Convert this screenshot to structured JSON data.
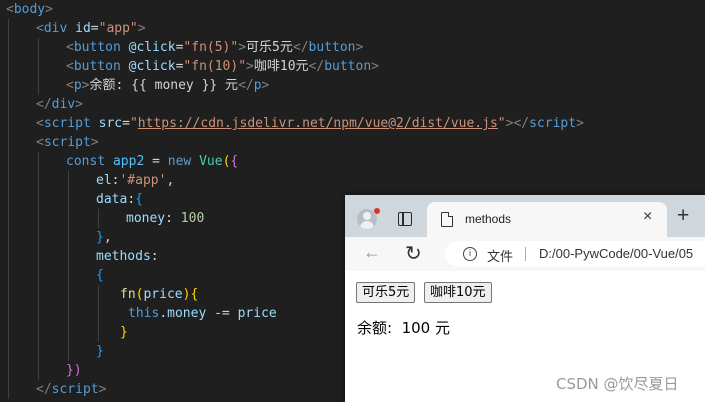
{
  "code": {
    "lines": [
      {
        "tokens": [
          [
            "<",
            "punc"
          ],
          [
            "body",
            "tag"
          ],
          [
            ">",
            "punc"
          ]
        ]
      },
      {
        "tokens": [
          [
            "<",
            "punc"
          ],
          [
            "div",
            "tag"
          ],
          [
            " ",
            ""
          ],
          [
            "id",
            "attr"
          ],
          [
            "=",
            "text"
          ],
          [
            "\"app\"",
            "str"
          ],
          [
            ">",
            "punc"
          ]
        ]
      },
      {
        "tokens": [
          [
            "<",
            "punc"
          ],
          [
            "button",
            "tag"
          ],
          [
            " ",
            ""
          ],
          [
            "@click",
            "attr"
          ],
          [
            "=",
            "text"
          ],
          [
            "\"fn(5)\"",
            "str"
          ],
          [
            ">",
            "punc"
          ],
          [
            "可乐5元",
            "text"
          ],
          [
            "</",
            "punc"
          ],
          [
            "button",
            "tag"
          ],
          [
            ">",
            "punc"
          ]
        ]
      },
      {
        "tokens": [
          [
            "<",
            "punc"
          ],
          [
            "button",
            "tag"
          ],
          [
            " ",
            ""
          ],
          [
            "@click",
            "attr"
          ],
          [
            "=",
            "text"
          ],
          [
            "\"fn(10)\"",
            "str"
          ],
          [
            ">",
            "punc"
          ],
          [
            "咖啡10元",
            "text"
          ],
          [
            "</",
            "punc"
          ],
          [
            "button",
            "tag"
          ],
          [
            ">",
            "punc"
          ]
        ]
      },
      {
        "tokens": [
          [
            "<",
            "punc"
          ],
          [
            "p",
            "tag"
          ],
          [
            ">",
            "punc"
          ],
          [
            "余额: {{ money }} 元",
            "text"
          ],
          [
            "</",
            "punc"
          ],
          [
            "p",
            "tag"
          ],
          [
            ">",
            "punc"
          ]
        ]
      },
      {
        "tokens": [
          [
            "</",
            "punc"
          ],
          [
            "div",
            "tag"
          ],
          [
            ">",
            "punc"
          ]
        ]
      },
      {
        "tokens": [
          [
            "<",
            "punc"
          ],
          [
            "script",
            "tag"
          ],
          [
            " ",
            ""
          ],
          [
            "src",
            "attr"
          ],
          [
            "=",
            "text"
          ],
          [
            "\"",
            "str"
          ],
          [
            "https://cdn.jsdelivr.net/npm/vue@2/dist/vue.js",
            "link"
          ],
          [
            "\"",
            "str"
          ],
          [
            "></",
            "punc"
          ],
          [
            "script",
            "tag"
          ],
          [
            ">",
            "punc"
          ]
        ]
      },
      {
        "tokens": [
          [
            "<",
            "punc"
          ],
          [
            "script",
            "tag"
          ],
          [
            ">",
            "punc"
          ]
        ]
      },
      {
        "tokens": [
          [
            "const",
            "kw"
          ],
          [
            " ",
            ""
          ],
          [
            "app2",
            "var"
          ],
          [
            " = ",
            "op"
          ],
          [
            "new",
            "kw"
          ],
          [
            " ",
            ""
          ],
          [
            "Vue",
            "cls"
          ],
          [
            "(",
            "br1"
          ],
          [
            "{",
            "br2"
          ]
        ]
      },
      {
        "tokens": [
          [
            "el",
            "prop"
          ],
          [
            ":",
            "op"
          ],
          [
            "'#app'",
            "str"
          ],
          [
            ",",
            "op"
          ]
        ]
      },
      {
        "tokens": [
          [
            "data",
            "prop"
          ],
          [
            ":",
            "op"
          ],
          [
            "{",
            "br3"
          ]
        ]
      },
      {
        "tokens": [
          [
            "money",
            "prop"
          ],
          [
            ": ",
            "op"
          ],
          [
            "100",
            "num"
          ]
        ]
      },
      {
        "tokens": [
          [
            "}",
            "br3"
          ],
          [
            ",",
            "op"
          ]
        ]
      },
      {
        "tokens": [
          [
            "methods",
            "prop"
          ],
          [
            ":",
            "op"
          ]
        ]
      },
      {
        "tokens": [
          [
            "{",
            "br3"
          ]
        ]
      },
      {
        "tokens": [
          [
            "fn",
            "fn"
          ],
          [
            "(",
            "br1"
          ],
          [
            "price",
            "prop"
          ],
          [
            ")",
            "br1"
          ],
          [
            "{",
            "br1"
          ]
        ]
      },
      {
        "tokens": [
          [
            "this",
            "kw"
          ],
          [
            ".",
            "op"
          ],
          [
            "money",
            "prop"
          ],
          [
            " -= ",
            "op"
          ],
          [
            "price",
            "prop"
          ]
        ]
      },
      {
        "tokens": [
          [
            "}",
            "br1"
          ]
        ]
      },
      {
        "tokens": [
          [
            "}",
            "br3"
          ]
        ]
      },
      {
        "tokens": [
          [
            "})",
            "br2"
          ]
        ]
      },
      {
        "tokens": [
          [
            "</",
            "punc"
          ],
          [
            "script",
            "tag"
          ],
          [
            ">",
            "punc"
          ]
        ]
      }
    ]
  },
  "browser": {
    "tab_title": "methods",
    "tab_close": "×",
    "new_tab": "+",
    "back_icon": "←",
    "reload_icon": "↻",
    "info_icon": "i",
    "file_label": "文件",
    "url": "D:/00-PywCode/00-Vue/05",
    "buttons": {
      "cola": "可乐5元",
      "coffee": "咖啡10元"
    },
    "balance_text": "余额:  100 元"
  },
  "watermark": "CSDN @饮尽夏日"
}
